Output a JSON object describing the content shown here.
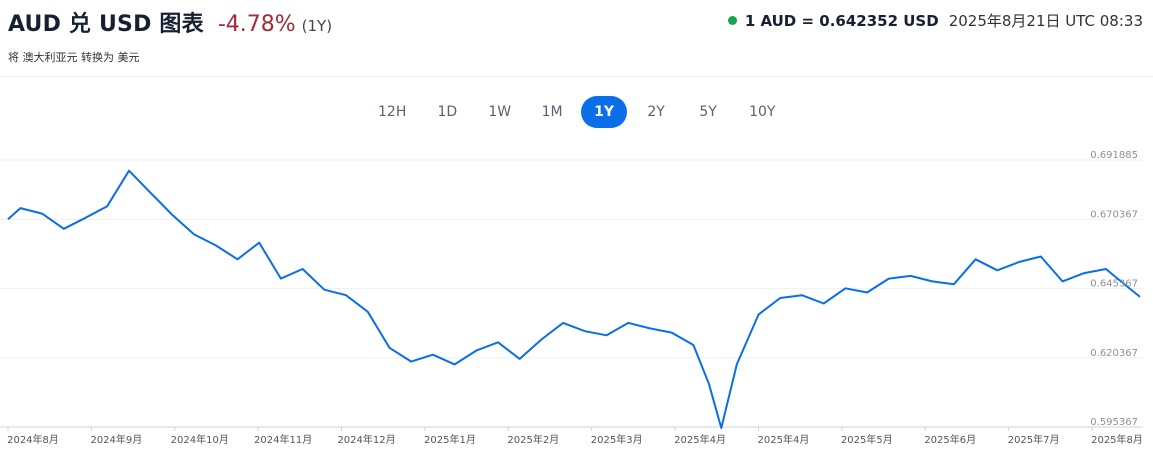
{
  "header": {
    "title": "AUD 兑 USD 图表",
    "change": "-4.78%",
    "period": "(1Y)",
    "subtitle": "将 澳大利亚元 转换为 美元",
    "rate": "1 AUD = 0.642352 USD",
    "timestamp": "2025年8月21日 UTC 08:33"
  },
  "period_tabs": [
    {
      "label": "12H",
      "active": false
    },
    {
      "label": "1D",
      "active": false
    },
    {
      "label": "1W",
      "active": false
    },
    {
      "label": "1M",
      "active": false
    },
    {
      "label": "1Y",
      "active": true
    },
    {
      "label": "2Y",
      "active": false
    },
    {
      "label": "5Y",
      "active": false
    },
    {
      "label": "10Y",
      "active": false
    }
  ],
  "colors": {
    "line": "#0a6ee8",
    "negative": "#a52a3a",
    "live": "#17a34a",
    "tab_active": "#0a6ee8"
  },
  "chart_data": {
    "type": "line",
    "title": "",
    "xlabel": "",
    "ylabel": "",
    "ylim": [
      0.595367,
      0.691885
    ],
    "x_ticks": [
      "2024年8月",
      "2024年9月",
      "2024年10月",
      "2024年11月",
      "2024年12月",
      "2025年1月",
      "2025年2月",
      "2025年3月",
      "2025年4月",
      "2025年4月",
      "2025年5月",
      "2025年6月",
      "2025年7月",
      "2025年8月"
    ],
    "y_ticks": [
      0.691885,
      0.670367,
      0.645367,
      0.620367,
      0.595367
    ],
    "series": [
      {
        "name": "",
        "x": [
          "2024-08-21",
          "2024-08-25",
          "2024-09-01",
          "2024-09-08",
          "2024-09-15",
          "2024-09-22",
          "2024-09-29",
          "2024-10-06",
          "2024-10-13",
          "2024-10-20",
          "2024-10-27",
          "2024-11-03",
          "2024-11-10",
          "2024-11-17",
          "2024-11-24",
          "2024-12-01",
          "2024-12-08",
          "2024-12-15",
          "2024-12-22",
          "2024-12-29",
          "2025-01-05",
          "2025-01-12",
          "2025-01-19",
          "2025-01-26",
          "2025-02-02",
          "2025-02-09",
          "2025-02-16",
          "2025-02-23",
          "2025-03-02",
          "2025-03-09",
          "2025-03-16",
          "2025-03-23",
          "2025-03-30",
          "2025-04-04",
          "2025-04-08",
          "2025-04-13",
          "2025-04-20",
          "2025-04-27",
          "2025-05-04",
          "2025-05-11",
          "2025-05-18",
          "2025-05-25",
          "2025-06-01",
          "2025-06-08",
          "2025-06-15",
          "2025-06-22",
          "2025-06-29",
          "2025-07-06",
          "2025-07-13",
          "2025-07-20",
          "2025-07-27",
          "2025-08-03",
          "2025-08-10",
          "2025-08-17",
          "2025-08-21"
        ],
        "y": [
          0.6705,
          0.6745,
          0.6725,
          0.667,
          0.671,
          0.6752,
          0.688,
          0.68,
          0.672,
          0.665,
          0.661,
          0.656,
          0.662,
          0.649,
          0.6525,
          0.645,
          0.643,
          0.637,
          0.624,
          0.619,
          0.6215,
          0.618,
          0.623,
          0.626,
          0.62,
          0.627,
          0.633,
          0.63,
          0.6285,
          0.633,
          0.631,
          0.6295,
          0.625,
          0.611,
          0.595,
          0.618,
          0.636,
          0.642,
          0.643,
          0.64,
          0.6455,
          0.644,
          0.649,
          0.65,
          0.648,
          0.647,
          0.656,
          0.652,
          0.655,
          0.657,
          0.648,
          0.651,
          0.6525,
          0.646,
          0.6424
        ]
      }
    ]
  }
}
